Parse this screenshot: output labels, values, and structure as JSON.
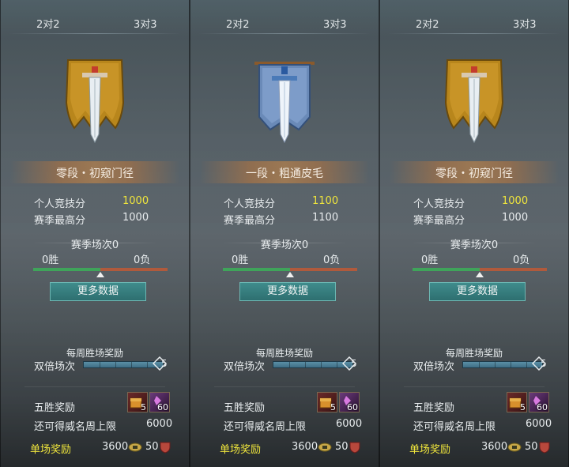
{
  "panels": [
    {
      "tabs": [
        "2对2",
        "3对3"
      ],
      "active_tab": "3对3",
      "emblem": "gold-banner-sword",
      "rank_name": "零段・初窥门径",
      "stats": [
        {
          "label": "个人竞技分",
          "value": "1000",
          "highlight": true
        },
        {
          "label": "赛季最高分",
          "value": "1000",
          "highlight": false
        }
      ],
      "season_title": "赛季场次0",
      "wins": "0胜",
      "losses": "0负",
      "win_ratio": 0.5,
      "more_button": "更多数据",
      "weekly_title": "每周胜场奖励",
      "double_label": "双倍场次",
      "double_count": "5",
      "five_win_label": "五胜奖励",
      "five_win_items": [
        "5",
        "60"
      ],
      "remaining_label": "还可得威名周上限",
      "remaining_value": "6000",
      "single_label": "单场奖励",
      "single_value1": "3600",
      "single_value2": "50"
    },
    {
      "tabs": [
        "2对2",
        "3对3"
      ],
      "active_tab": "3对3",
      "emblem": "blue-banner-sword",
      "rank_name": "一段・粗通皮毛",
      "stats": [
        {
          "label": "个人竞技分",
          "value": "1100",
          "highlight": true
        },
        {
          "label": "赛季最高分",
          "value": "1100",
          "highlight": false
        }
      ],
      "season_title": "赛季场次0",
      "wins": "0胜",
      "losses": "0负",
      "win_ratio": 0.5,
      "more_button": "更多数据",
      "weekly_title": "每周胜场奖励",
      "double_label": "双倍场次",
      "double_count": "5",
      "five_win_label": "五胜奖励",
      "five_win_items": [
        "5",
        "60"
      ],
      "remaining_label": "还可得威名周上限",
      "remaining_value": "6000",
      "single_label": "单场奖励",
      "single_value1": "3600",
      "single_value2": "50"
    },
    {
      "tabs": [
        "2对2",
        "3对3"
      ],
      "active_tab": "3对3",
      "emblem": "gold-banner-sword",
      "rank_name": "零段・初窥门径",
      "stats": [
        {
          "label": "个人竞技分",
          "value": "1000",
          "highlight": true
        },
        {
          "label": "赛季最高分",
          "value": "1000",
          "highlight": false
        }
      ],
      "season_title": "赛季场次0",
      "wins": "0胜",
      "losses": "0负",
      "win_ratio": 0.5,
      "more_button": "更多数据",
      "weekly_title": "每周胜场奖励",
      "double_label": "双倍场次",
      "double_count": "5",
      "five_win_label": "五胜奖励",
      "five_win_items": [
        "5",
        "60"
      ],
      "remaining_label": "还可得威名周上限",
      "remaining_value": "6000",
      "single_label": "单场奖励",
      "single_value1": "3600",
      "single_value2": "50"
    }
  ],
  "colors": {
    "highlight": "#f0e63c",
    "win_bar": "#3fa45a",
    "loss_bar": "#b05a3c",
    "button": "#2e6f70"
  }
}
